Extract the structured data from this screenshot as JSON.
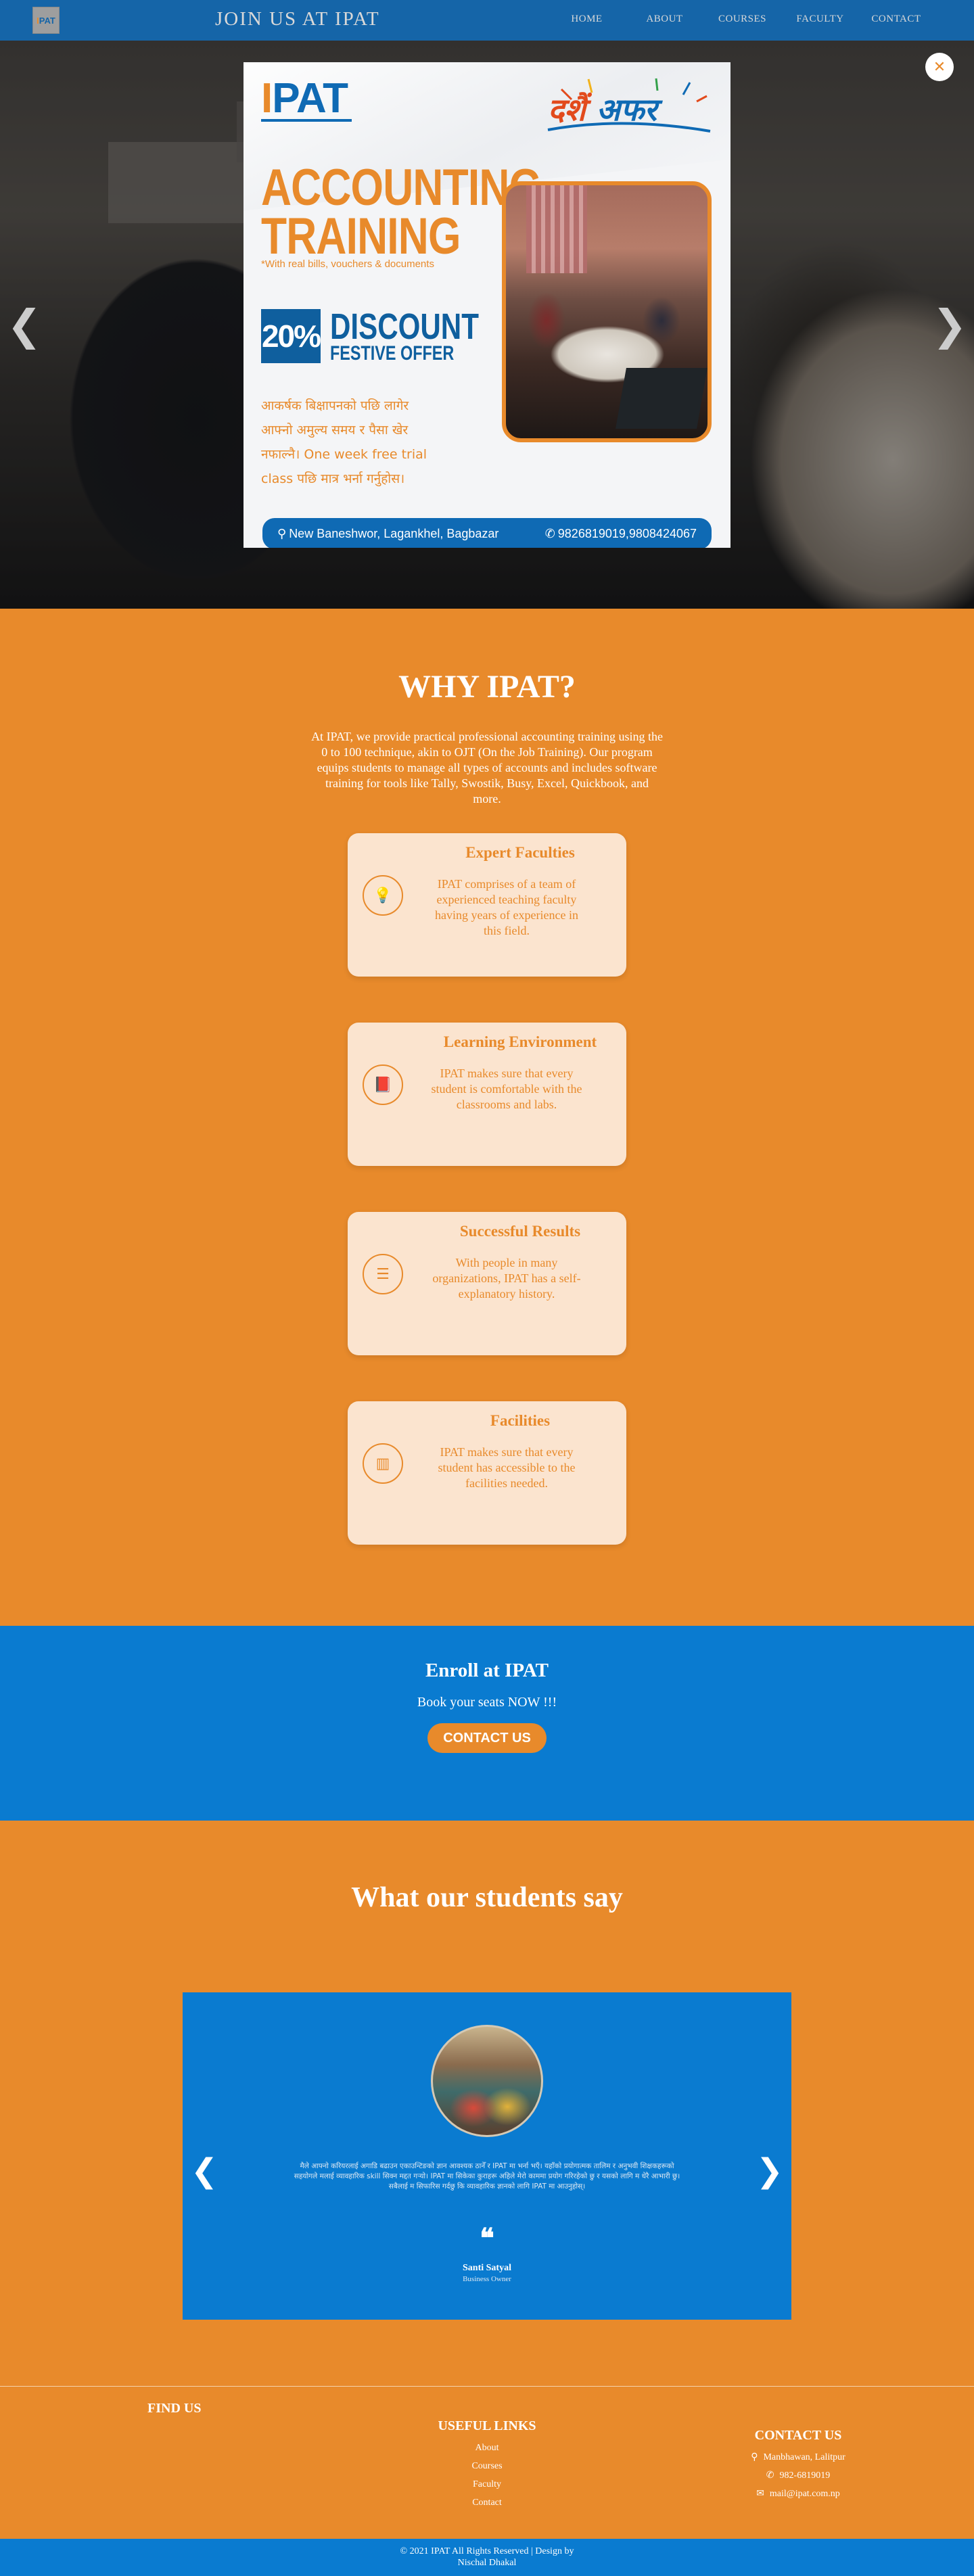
{
  "nav": {
    "logo_i": "I",
    "logo_rest": "PAT",
    "title": "JOIN US AT IPAT",
    "links": [
      "HOME",
      "ABOUT",
      "COURSES",
      "FACULTY",
      "CONTACT"
    ]
  },
  "hero": {
    "prev_arrow": "❮",
    "next_arrow": "❯"
  },
  "popup": {
    "close_symbol": "✕",
    "logo_i": "I",
    "logo_rest": "PAT",
    "festive_first": "दशैं",
    "festive_rest": " अफर",
    "headline_line1": "ACCOUNTING",
    "headline_line2": "TRAINING",
    "subline": "*With real bills, vouchers & documents",
    "discount_value": "20%",
    "discount_title": "DISCOUNT",
    "discount_sub": "FESTIVE OFFER",
    "body_line1": "आकर्षक बिक्षापनको पछि लागेर",
    "body_line2": "आफ्नो अमुल्य समय र पैसा खेर",
    "body_line3": "नफाल्नै। One week free trial",
    "body_line4": "class पछि मात्र भर्ना गर्नुहोस।",
    "address": "New Baneshwor, Lagankhel, Bagbazar",
    "phones": "9826819019,9808424067"
  },
  "why": {
    "title": "WHY IPAT?",
    "intro": "At IPAT, we provide practical professional accounting training using the 0 to 100 technique, akin to OJT (On the Job Training). Our program equips students to manage all types of accounts and includes software training for tools like Tally, Swostik, Busy, Excel, Quickbook, and more.",
    "cards": [
      {
        "title": "Expert Faculties",
        "text": "IPAT comprises of a team of experienced teaching faculty having years of experience in this field.",
        "icon": "lightbulb-icon"
      },
      {
        "title": "Learning Environment",
        "text": "IPAT makes sure that every student is comfortable with the classrooms and labs.",
        "icon": "book-icon"
      },
      {
        "title": "Successful Results",
        "text": "With people in many organizations, IPAT has a self-explanatory history.",
        "icon": "list-icon"
      },
      {
        "title": "Facilities",
        "text": "IPAT makes sure that every student has accessible to the facilities needed.",
        "icon": "building-icon"
      }
    ]
  },
  "enroll": {
    "title": "Enroll at IPAT",
    "subtitle": "Book your seats NOW !!!",
    "button": "CONTACT US"
  },
  "testimonials": {
    "title": "What our students say",
    "text": "मैले आफ्नो करियरलाई अगाडि बढाउन एकाउन्टिङको ज्ञान आवश्यक ठानेँ र IPAT मा भर्ना भएँ। यहाँको प्रयोगात्मक तालिम र अनुभवी शिक्षकहरूको सहयोगले मलाई व्यावहारिक skill सिक्न मद्दत गर्‍यो। IPAT मा सिकेका कुराहरू अहिले मेरो काममा प्रयोग गरिरहेको छु र यसको लागि म धेरै आभारी छु। सबैलाई म सिफारिस गर्दछु कि व्यावहारिक ज्ञानको लागि IPAT मा आउनुहोस्।",
    "quote_mark": "❝",
    "name": "Santi Satyal",
    "role": "Business Owner",
    "prev_arrow": "❮",
    "next_arrow": "❯"
  },
  "footer": {
    "find_us": "FIND US",
    "links_title": "USEFUL LINKS",
    "links": [
      "About",
      "Courses",
      "Faculty",
      "Contact"
    ],
    "contact_title": "CONTACT US",
    "address": "Manbhawan, Lalitpur",
    "phone": "982-6819019",
    "email": "mail@ipat.com.np",
    "copyright": "© 2021 IPAT All Rights Reserved | Design by Nischal Dhakal"
  },
  "colors": {
    "orange": "#e88a2b",
    "blue": "#0a7bd0",
    "nav_blue": "#1565a8",
    "card_bg": "#fbe4cf"
  }
}
